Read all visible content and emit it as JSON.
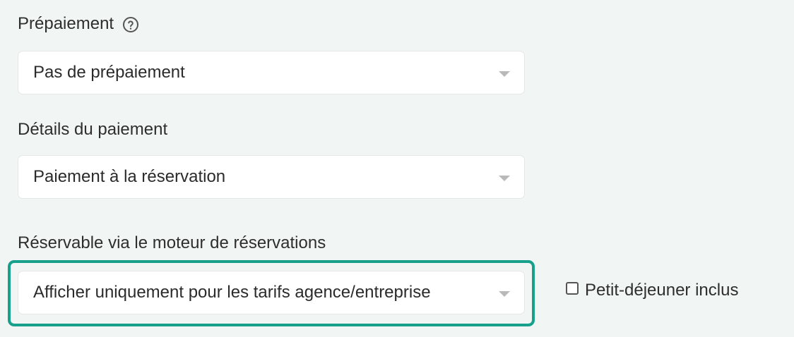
{
  "prepayment": {
    "label": "Prépaiement",
    "help_icon": "help-circle-icon",
    "selected": "Pas de prépaiement"
  },
  "payment_details": {
    "label": "Détails du paiement",
    "selected": "Paiement à la réservation"
  },
  "booking_engine": {
    "label": "Réservable via le moteur de réservations",
    "selected": "Afficher uniquement pour les tarifs agence/entreprise",
    "highlight_color": "#17a08c"
  },
  "breakfast": {
    "label": "Petit-déjeuner inclus",
    "checked": false
  }
}
